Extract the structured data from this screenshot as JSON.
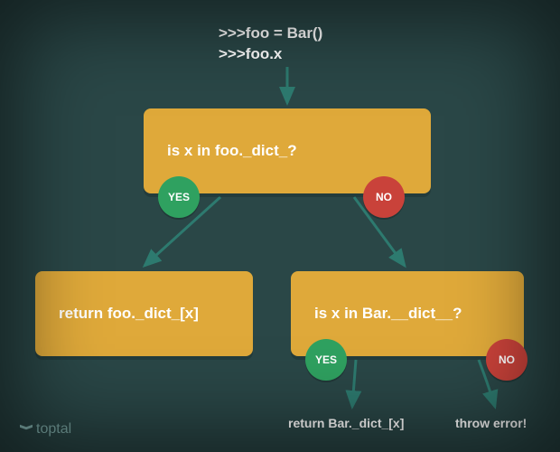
{
  "code": {
    "line1": ">>>foo = Bar()",
    "line2": ">>>foo.x"
  },
  "boxes": {
    "q1": "is x in foo._dict_?",
    "r_left": "return foo._dict_[x]",
    "q2": "is x in Bar.__dict__?"
  },
  "badges": {
    "yes": "YES",
    "no": "NO"
  },
  "results": {
    "left": "return Bar._dict_[x]",
    "right": "throw error!"
  },
  "logo": "toptal",
  "colors": {
    "bg": "#2a4747",
    "box": "#dfa93a",
    "yes": "#2fa160",
    "no": "#c9423a",
    "arrow": "#2d7a6f"
  }
}
